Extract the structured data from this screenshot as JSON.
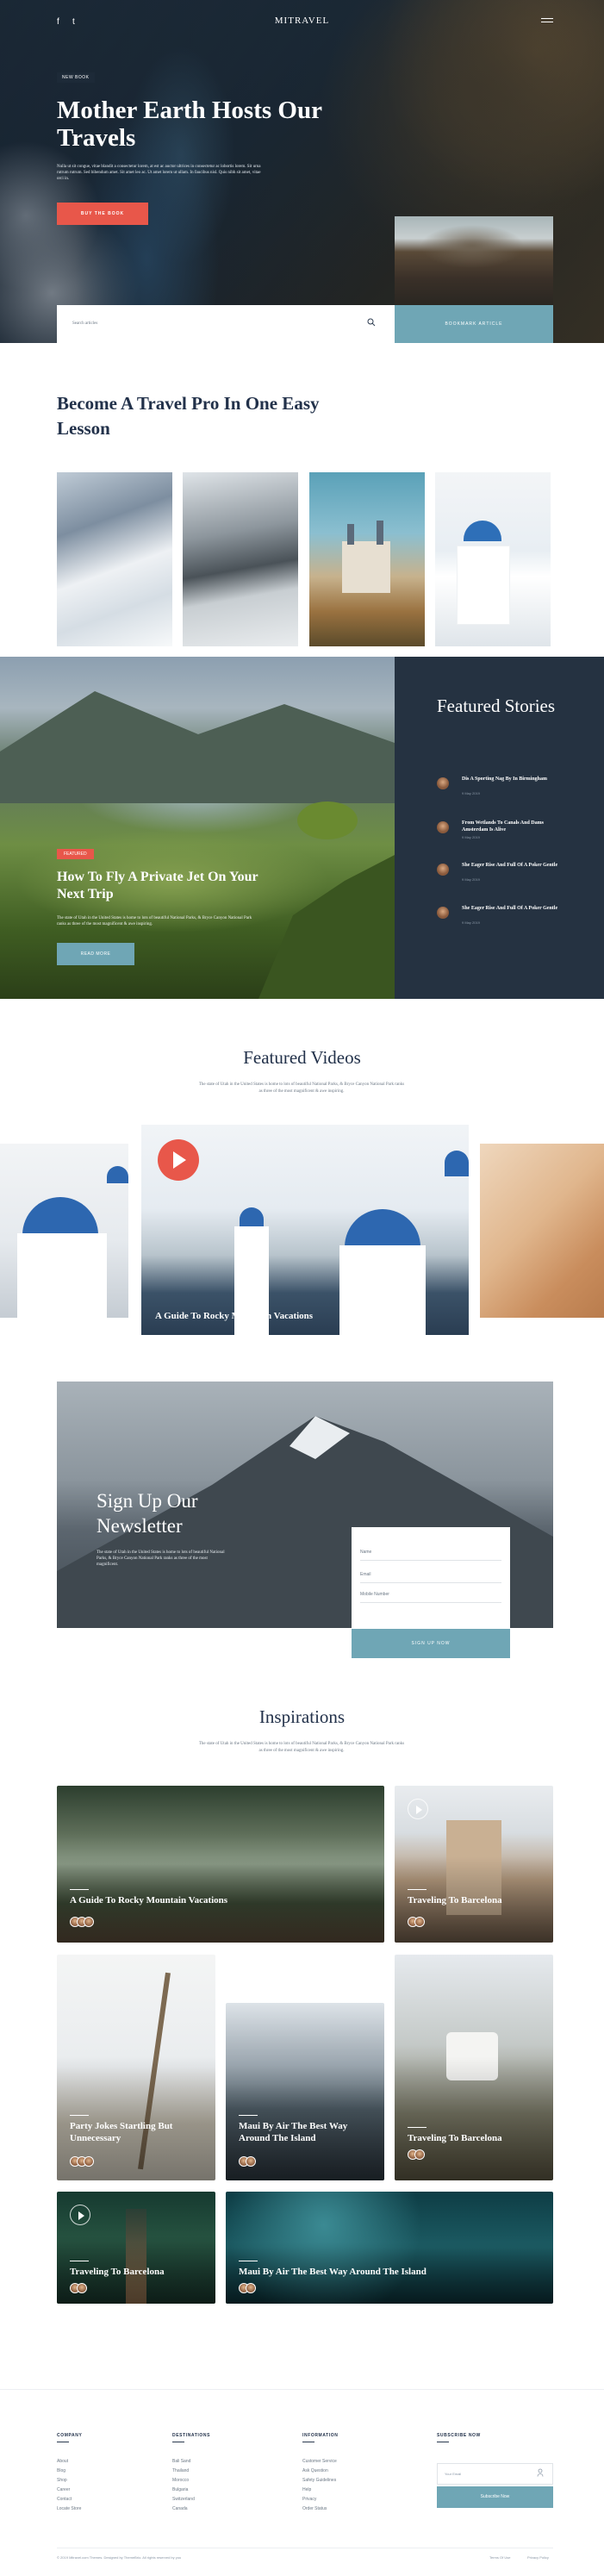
{
  "header": {
    "logo": "MITRAVEL",
    "social": [
      "f",
      "t"
    ]
  },
  "hero": {
    "badge": "NEW BOOK",
    "title": "Mother Earth Hosts Our Travels",
    "text": "Nulla ut sit congue, vitae blandit a consectetur lorem, at est ac auctor ultrices in consectetur ac lobortis lorem. Sit urna rutrum rutrum. Sed bibendum amet. Sit amet leo ac. Ut amet lorem ut ullam. In faucibus nisl. Quis nibh sit amet, vitae orci in.",
    "button": "BUY THE BOOK",
    "search_placeholder": "Search articles",
    "cta": "BOOKMARK ARTICLE"
  },
  "pro": {
    "title": "Become A Travel Pro In One Easy Lesson"
  },
  "featured_story": {
    "badge": "FEATURED",
    "title": "How To Fly A Private Jet On Your Next Trip",
    "text": "The state of Utah in the United States is home to lots of beautiful National Parks, & Bryce Canyon National Park ranks as three of the most magnificent & awe inspiring.",
    "button": "READ MORE"
  },
  "featured_stories": {
    "title": "Featured Stories",
    "items": [
      {
        "title": "Dis A Sporting Nag By In Birmingham",
        "date": "9 May 2019"
      },
      {
        "title": "From Wetlands To Canals And Dams Amsterdam Is Alive",
        "date": "9 May 2019"
      },
      {
        "title": "She Eager Rise And Full Of A Poker Gentle",
        "date": "9 May 2019"
      },
      {
        "title": "She Eager Rise And Full Of A Poker Gentle",
        "date": "9 May 2019"
      }
    ]
  },
  "videos": {
    "title": "Featured Videos",
    "subtitle": "The state of Utah in the United States is home to lots of beautiful National Parks, & Bryce Canyon National Park ranks as three of the most magnificent & awe inspiring.",
    "caption": "A Guide To Rocky Mountain Vacations"
  },
  "signup": {
    "title": "Sign Up Our Newsletter",
    "text": "The state of Utah in the United States is home to lots of beautiful National Parks, & Bryce Canyon National Park ranks as three of the most magnificent.",
    "fields": [
      "Name",
      "Email",
      "Mobile Number"
    ],
    "button": "SIGN UP NOW"
  },
  "inspirations": {
    "title": "Inspirations",
    "subtitle": "The state of Utah in the United States is home to lots of beautiful National Parks, & Bryce Canyon National Park ranks as three of the most magnificent & awe inspiring.",
    "cards": [
      "A Guide To Rocky Mountain Vacations",
      "Traveling To Barcelona",
      "Party Jokes Startling But Unnecessary",
      "Maui By Air The Best Way Around The Island",
      "Traveling To Barcelona",
      "Traveling To Barcelona",
      "Maui By Air The Best Way Around The Island"
    ]
  },
  "footer": {
    "columns": [
      {
        "title": "COMPANY",
        "links": [
          "About",
          "Blog",
          "Shop",
          "Career",
          "Contact",
          "Locate Store"
        ]
      },
      {
        "title": "DESTINATIONS",
        "links": [
          "Bali Sand",
          "Thailand",
          "Morocco",
          "Bulgaria",
          "Switzerland",
          "Canada"
        ]
      },
      {
        "title": "INFORMATION",
        "links": [
          "Customer Service",
          "Ask Question",
          "Safety Guidelines",
          "Help",
          "Privacy",
          "Order Status"
        ]
      }
    ],
    "subscribe": {
      "title": "SUBSCRIBE NOW",
      "placeholder": "Your Email",
      "button": "Subscribe Now"
    },
    "copyright": "© 2019 Mitravel.com Themes. Designed by ThemeBrio. All rights reserved by you",
    "legal": [
      "Terms Of Use",
      "Privacy Policy"
    ]
  }
}
